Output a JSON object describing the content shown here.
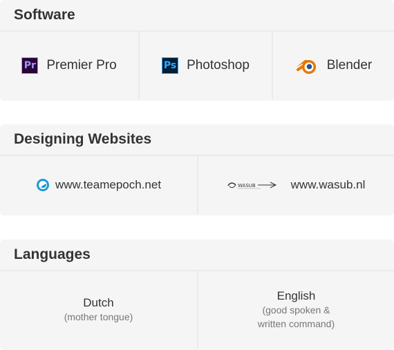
{
  "software": {
    "title": "Software",
    "items": [
      {
        "label": "Premier Pro",
        "icon": "premiere-pro-icon",
        "icon_text": "Pr",
        "icon_color": "#9999ff"
      },
      {
        "label": "Photoshop",
        "icon": "photoshop-icon",
        "icon_text": "Ps",
        "icon_color": "#31a8ff"
      },
      {
        "label": "Blender",
        "icon": "blender-icon",
        "icon_color": "#ea7600"
      }
    ]
  },
  "websites": {
    "title": "Designing Websites",
    "items": [
      {
        "label": "www.teamepoch.net",
        "icon": "teamepoch-logo-icon",
        "icon_color": "#1a9ad6"
      },
      {
        "label": "www.wasub.nl",
        "icon": "wasub-logo-icon",
        "logo_text": "WASUB"
      }
    ]
  },
  "languages": {
    "title": "Languages",
    "items": [
      {
        "name": "Dutch",
        "note": "(mother tongue)"
      },
      {
        "name": "English",
        "note": "(good spoken &\nwritten command)"
      }
    ]
  },
  "colors": {
    "card_background": "#f5f5f5",
    "divider": "#eaeaea",
    "text": "#333333",
    "muted_text": "#777777"
  }
}
